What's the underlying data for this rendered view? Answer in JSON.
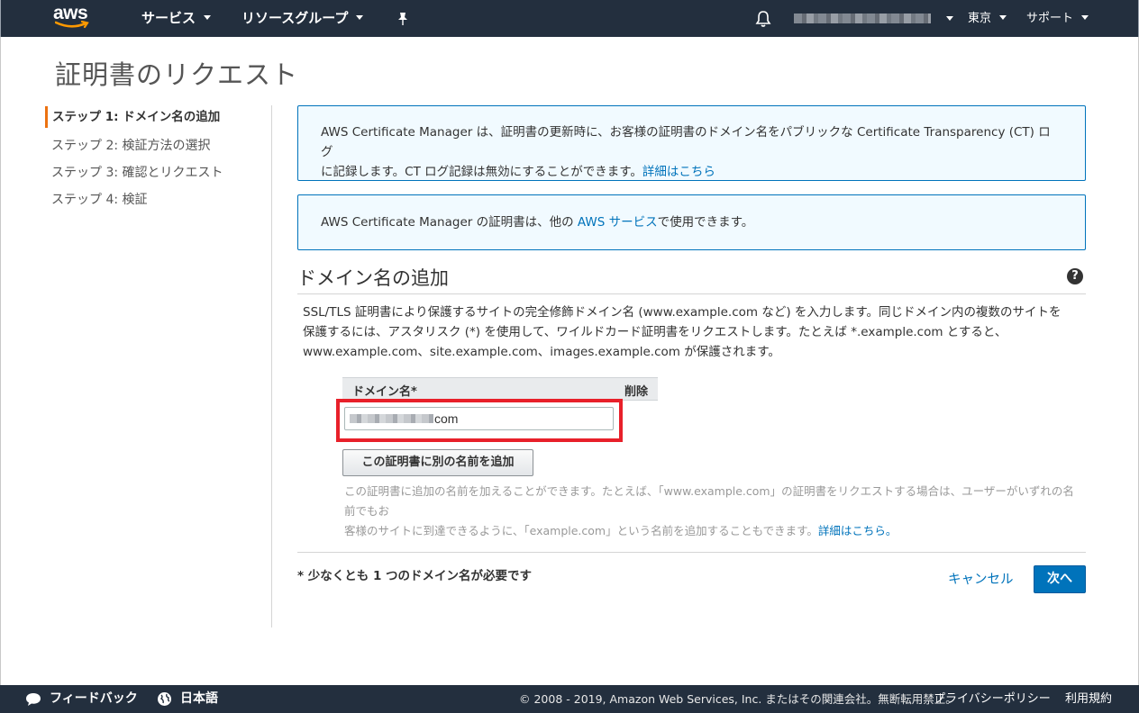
{
  "nav": {
    "logo": "aws",
    "services": "サービス",
    "resource_groups": "リソースグループ",
    "region": "東京",
    "support": "サポート"
  },
  "page": {
    "title": "証明書のリクエスト"
  },
  "steps": [
    {
      "label": "ステップ 1: ドメイン名の追加",
      "active": true
    },
    {
      "label": "ステップ 2: 検証方法の選択"
    },
    {
      "label": "ステップ 3: 確認とリクエスト"
    },
    {
      "label": "ステップ 4: 検証"
    }
  ],
  "info1": {
    "line1": "AWS Certificate Manager は、証明書の更新時に、お客様の証明書のドメイン名をパブリックな Certificate Transparency (CT) ログ",
    "line2": "に記録します。CT ログ記録は無効にすることができます。",
    "link": "詳細はこちら"
  },
  "info2": {
    "before": "AWS Certificate Manager の証明書は、他の ",
    "link": "AWS サービス",
    "after": "で使用できます。"
  },
  "section": {
    "title": "ドメイン名の追加",
    "help": "?",
    "desc1": "SSL/TLS 証明書により保護するサイトの完全修飾ドメイン名 (www.example.com など) を入力します。同じドメイン内の複数のサイトを",
    "desc2": "保護するには、アスタリスク (*) を使用して、ワイルドカード証明書をリクエストします。たとえば *.example.com とすると、",
    "desc3": "www.example.com、site.example.com、images.example.com が保護されます。"
  },
  "table": {
    "col_domain": "ドメイン名*",
    "col_delete": "削除",
    "domain_value": "com"
  },
  "add_button": "この証明書に別の名前を追加",
  "hint": {
    "line1": "この証明書に追加の名前を加えることができます。たとえば、「www.example.com」の証明書をリクエストする場合は、ユーザーがいずれの名前でもお",
    "line2": "客様のサイトに到達できるように、「example.com」という名前を追加することもできます。",
    "link": "詳細はこちら。"
  },
  "footer_actions": {
    "required_note": "* 少なくとも 1 つのドメイン名が必要です",
    "cancel": "キャンセル",
    "next": "次へ"
  },
  "footer": {
    "feedback": "フィードバック",
    "language": "日本語",
    "copyright": "© 2008 - 2019, Amazon Web Services, Inc. またはその関連会社。無断転用禁止。",
    "privacy": "プライバシーポリシー",
    "terms": "利用規約"
  },
  "colors": {
    "nav_bg": "#232f3e",
    "accent": "#ec7211",
    "link": "#0073bb",
    "highlight": "#e8202a"
  }
}
